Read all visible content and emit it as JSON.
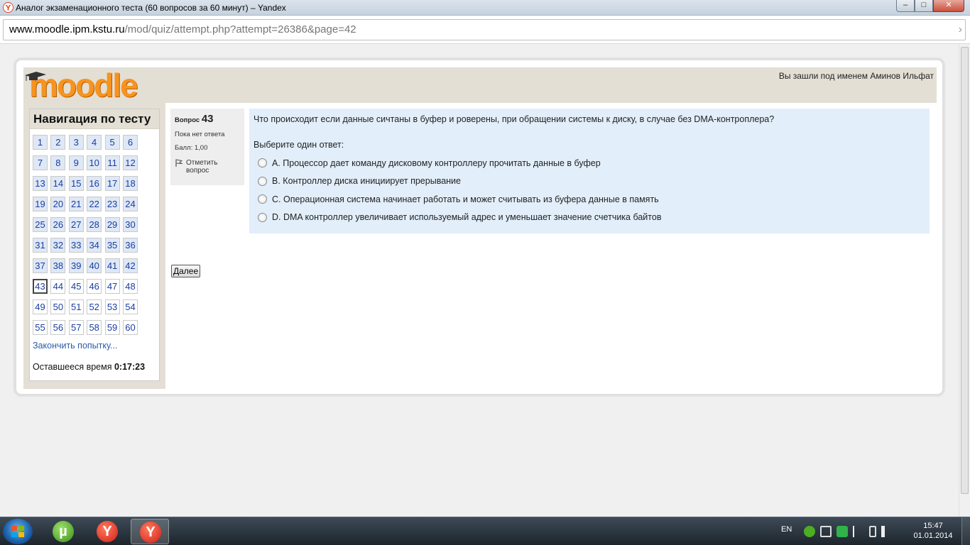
{
  "browser": {
    "window_title": "Аналог экзаменационного теста (60 вопросов за 60 минут) – Yandex",
    "url_host": "www.moodle.ipm.kstu.ru",
    "url_path": "/mod/quiz/attempt.php?attempt=26386&page=42"
  },
  "header": {
    "logo_text": "moodle",
    "login_info": "Вы зашли под именем Аминов Ильфат"
  },
  "nav": {
    "title": "Навигация по тесту",
    "questions": [
      "1",
      "2",
      "3",
      "4",
      "5",
      "6",
      "7",
      "8",
      "9",
      "10",
      "11",
      "12",
      "13",
      "14",
      "15",
      "16",
      "17",
      "18",
      "19",
      "20",
      "21",
      "22",
      "23",
      "24",
      "25",
      "26",
      "27",
      "28",
      "29",
      "30",
      "31",
      "32",
      "33",
      "34",
      "35",
      "36",
      "37",
      "38",
      "39",
      "40",
      "41",
      "42",
      "43",
      "44",
      "45",
      "46",
      "47",
      "48",
      "49",
      "50",
      "51",
      "52",
      "53",
      "54",
      "55",
      "56",
      "57",
      "58",
      "59",
      "60"
    ],
    "current_question": 43,
    "answered_through": 42,
    "finish_link": "Закончить попытку...",
    "timer_label": "Оставшееся время",
    "timer_value": "0:17:23"
  },
  "question": {
    "number_label": "Вопрос",
    "number": "43",
    "status": "Пока нет ответа",
    "grade": "Балл: 1,00",
    "flag_label": "Отметить вопрос",
    "text": "Что происходит если данные сичтаны в буфер и роверены, при обращении системы к диску, в случае без DMA-контроплера?",
    "prompt": "Выберите один ответ:",
    "answers": [
      "A. Процессор дает команду дисковому контроллеру прочитать данные в буфер",
      "B. Контроллер диска инициирует прерывание",
      "C. Операционная система начинает работать и может считывать из буфера данные в память",
      "D. DMA контроллер увеличивает используемый адрес и уменьшает значение счетчика байтов"
    ]
  },
  "next_button": "Далее",
  "taskbar": {
    "language": "EN",
    "time": "15:47",
    "date": "01.01.2014"
  },
  "colors": {
    "moodle_orange": "#f7931e",
    "header_bg": "#e3dfd4",
    "question_bg": "#e2eefa",
    "link_blue": "#2a5ca8"
  }
}
